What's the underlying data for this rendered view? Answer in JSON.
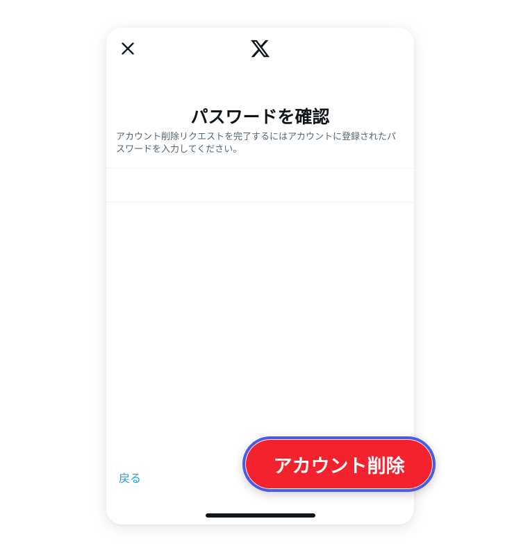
{
  "header": {
    "close_icon": "close-icon",
    "logo_icon": "x-logo-icon"
  },
  "title": "パスワードを確認",
  "description": "アカウント削除リクエストを完了するにはアカウントに登録されたパスワードを入力してください。",
  "password_field": {
    "value": "",
    "placeholder": ""
  },
  "footer": {
    "back_label": "戻る",
    "delete_label": "アカウント削除"
  },
  "colors": {
    "danger": "#f4212e",
    "link": "#1d9bf0",
    "focus_ring": "#4b5ae6",
    "text_primary": "#0f1419",
    "text_secondary": "#536471"
  }
}
